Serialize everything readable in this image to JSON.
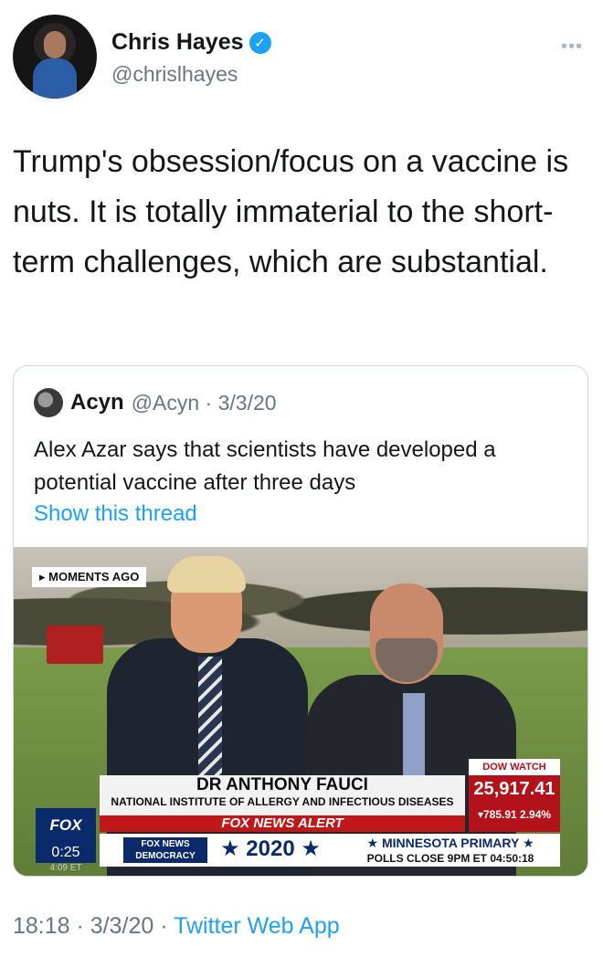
{
  "author": {
    "name": "Chris Hayes",
    "handle": "@chrislhayes",
    "verified": true,
    "verified_icon": "verified-badge-icon",
    "more_icon": "more-options-icon",
    "more_glyph": "•••"
  },
  "tweet": {
    "text": "Trump's obsession/focus on a vaccine is nuts. It is totally immaterial to the short-term challenges, which are substantial."
  },
  "quoted": {
    "name": "Acyn",
    "handle_date": "@Acyn · 3/3/20",
    "text": "Alex Azar says that scientists have developed a potential vaccine after three days",
    "show_thread": "Show this thread",
    "video": {
      "moments_label": "▸ MOMENTS AGO",
      "guest_name": "DR ANTHONY FAUCI",
      "guest_title": "NATIONAL INSTITUTE OF ALLERGY AND INFECTIOUS DISEASES",
      "alert": "FOX NEWS ALERT",
      "dow_label": "DOW WATCH",
      "dow_value": "25,917.41",
      "dow_change": "▾785.91 2.94%",
      "fox_democracy": "FOX NEWS DEMOCRACY",
      "year": "★ 2020 ★",
      "primary_title": "★ MINNESOTA PRIMARY ★",
      "primary_sub": "POLLS CLOSE 9PM ET 04:50:18",
      "channel_logo": "FOX",
      "timer": "0:25",
      "et_time": "4:09 ET"
    }
  },
  "meta": {
    "time_date": "18:18 · 3/3/20 · ",
    "app": "Twitter Web App"
  },
  "colors": {
    "link": "#1da1f2",
    "secondary_text": "#657786",
    "fox_red": "#c01818",
    "fox_blue": "#0b2a6b"
  }
}
